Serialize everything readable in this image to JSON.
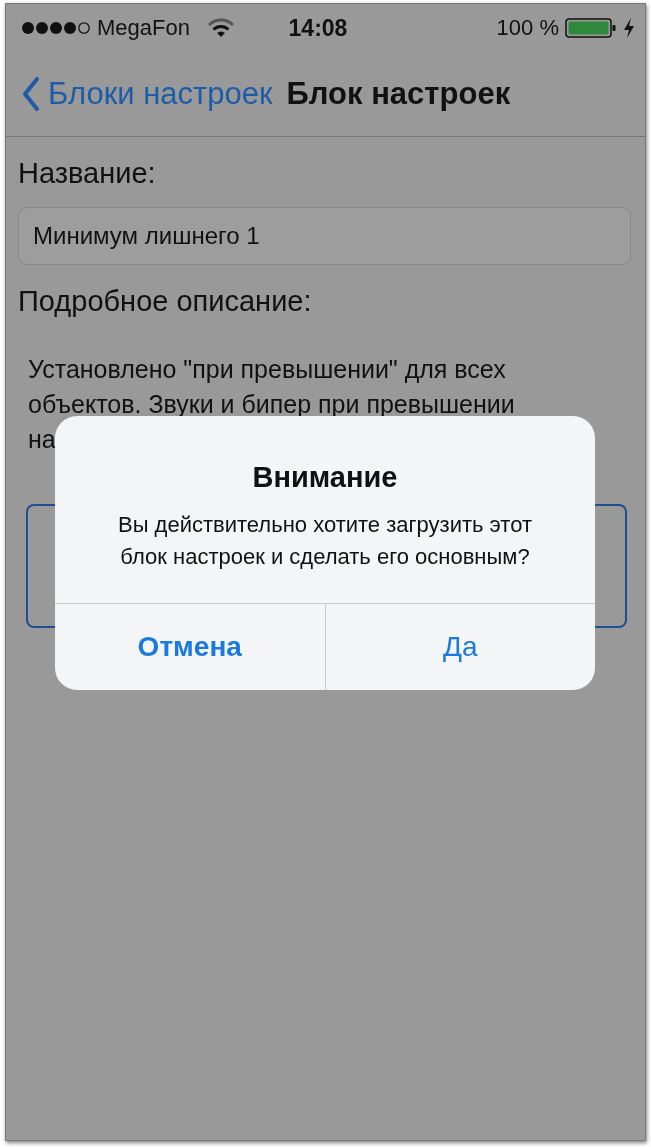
{
  "status_bar": {
    "carrier": "MegaFon",
    "time": "14:08",
    "battery": "100 %"
  },
  "nav": {
    "back_label": "Блоки настроек",
    "title": "Блок настроек"
  },
  "form": {
    "name_label": "Название:",
    "name_value": "Минимум лишнего 1",
    "description_label": "Подробное описание:",
    "description_lines": [
      "Установлено \"при превышении\" для всех",
      "объектов. Звуки и бипер при превышении",
      "на"
    ]
  },
  "dialog": {
    "title": "Внимание",
    "message": "Вы действительно хотите загрузить этот блок настроек и сделать его основным?",
    "buttons": [
      {
        "label": "Отмена",
        "kind": "cancel"
      },
      {
        "label": "Да",
        "kind": "default"
      }
    ]
  }
}
